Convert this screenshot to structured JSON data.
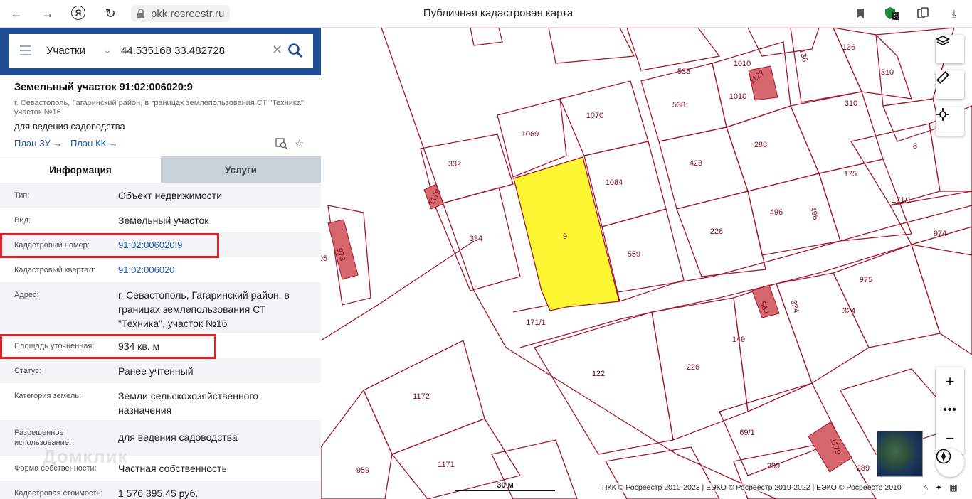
{
  "browser": {
    "url": "pkk.rosreestr.ru",
    "title": "Публичная кадастровая карта",
    "ext_badge": "3"
  },
  "search": {
    "type": "Участки",
    "value": "44.535168 33.482728"
  },
  "object": {
    "title": "Земельный участок 91:02:006020:9",
    "address": "г. Севастополь, Гагаринский район, в границах землепользования СТ \"Техника\", участок №16",
    "use": "для ведения садоводства",
    "plan_zu": "План ЗУ →",
    "plan_kk": "План КК →"
  },
  "tabs": {
    "info": "Информация",
    "services": "Услуги"
  },
  "rows": [
    {
      "label": "Тип:",
      "value": "Объект недвижимости"
    },
    {
      "label": "Вид:",
      "value": "Земельный участок"
    },
    {
      "label": "Кадастровый номер:",
      "value": "91:02:006020:9"
    },
    {
      "label": "Кадастровый квартал:",
      "value": "91:02:006020"
    },
    {
      "label": "Адрес:",
      "value": "г. Севастополь, Гагаринский район, в границах землепользования СТ \"Техника\", участок №16"
    },
    {
      "label": "Площадь уточненная:",
      "value": "934 кв. м"
    },
    {
      "label": "Статус:",
      "value": "Ранее учтенный"
    },
    {
      "label": "Категория земель:",
      "value": "Земли сельскохозяйственного назначения"
    },
    {
      "label": "Разрешенное использование:",
      "value": "для ведения садоводства"
    },
    {
      "label": "Форма собственности:",
      "value": "Частная собственность"
    },
    {
      "label": "Кадастровая стоимость:",
      "value": "1 576 895,45 руб."
    }
  ],
  "watermark": "Домклик",
  "map": {
    "scale": "30 м",
    "copyright": "ПКК © Росреестр 2010-2023 | ЕЭКО © Росреестр 2019-2022 | ЕЭКО © Росреестр 2010",
    "labels": [
      "1069",
      "1070",
      "1084",
      "559",
      "9",
      "332",
      "334",
      "1178",
      "171/1",
      "538",
      "1010",
      "1127",
      "538",
      "1010",
      "136",
      "136",
      "310",
      "310",
      "8",
      "423",
      "288",
      "175",
      "496",
      "496",
      "228",
      "171/1",
      "974",
      "975",
      "324",
      "324",
      "564",
      "149",
      "226",
      "122",
      "1172",
      "1171",
      "959",
      "69/1",
      "289",
      "289",
      "1179",
      "973",
      "05"
    ]
  },
  "colors": {
    "header_blue": "#1f4d96",
    "parcel_line": "#a3192f",
    "selected_fill": "#fff633",
    "building_fill": "#d7676f",
    "highlight_red": "#d9232d"
  }
}
